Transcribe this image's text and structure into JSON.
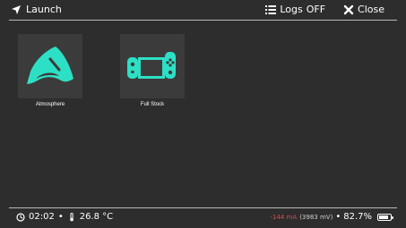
{
  "header": {
    "title": "Launch",
    "logs_label": "Logs",
    "logs_state": "OFF",
    "close_label": "Close"
  },
  "tiles": [
    {
      "label": "Atmosphere",
      "icon": "atmosphere-icon"
    },
    {
      "label": "Full Stock",
      "icon": "switch-console-icon"
    }
  ],
  "status": {
    "time": "02:02",
    "temperature": "26.8 °C",
    "current": "-144 mA",
    "voltage": "(3983 mV)",
    "battery_percent": "82.7%",
    "battery_level": 0.827
  },
  "colors": {
    "accent": "#2de0c5",
    "background": "#2d2d2d",
    "tile_background": "#3b3b3b",
    "current_red": "#d44d4d"
  }
}
